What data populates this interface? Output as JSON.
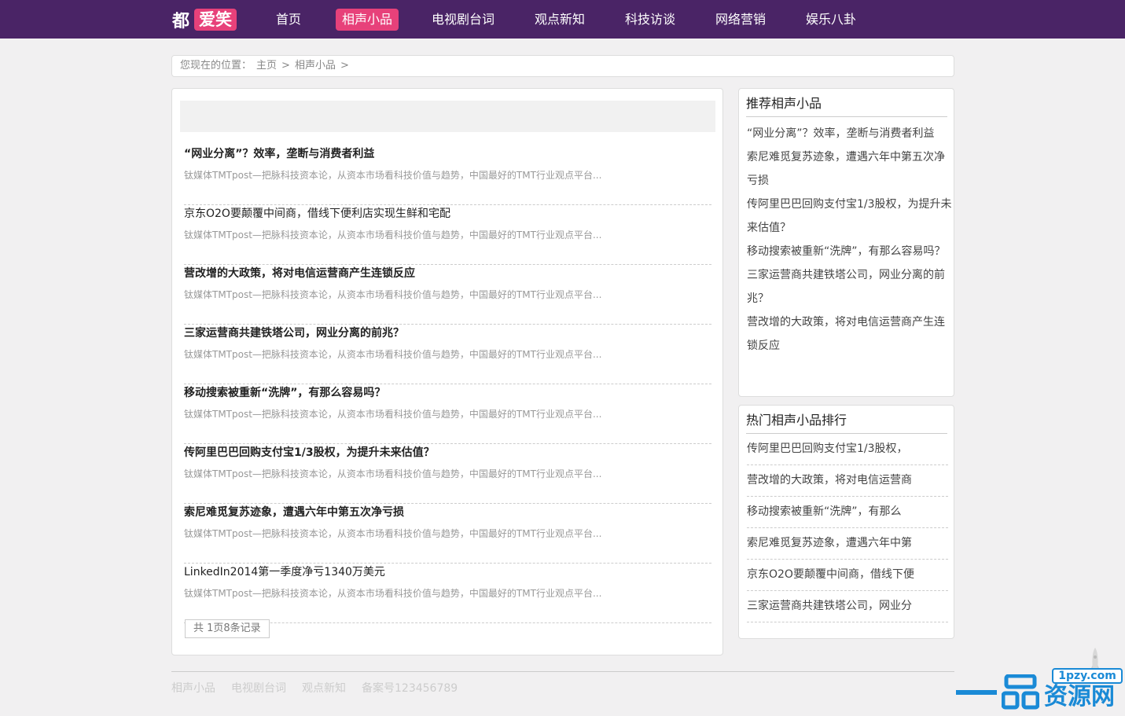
{
  "header": {
    "logo_main": "都",
    "logo_tag": "爱笑",
    "nav": [
      {
        "label": "首页",
        "active": false
      },
      {
        "label": "相声小品",
        "active": true
      },
      {
        "label": "电视剧台词",
        "active": false
      },
      {
        "label": "观点新知",
        "active": false
      },
      {
        "label": "科技访谈",
        "active": false
      },
      {
        "label": "网络营销",
        "active": false
      },
      {
        "label": "娱乐八卦",
        "active": false
      }
    ]
  },
  "breadcrumb": {
    "prefix": "您现在的位置：",
    "home": "主页",
    "sep": ">",
    "current": "相声小品",
    "trail_end": ">"
  },
  "articles": [
    {
      "title": "“网业分离”？效率，垄断与消费者利益",
      "bold": true,
      "summary": "钛媒体TMTpost—把脉科技资本论，从资本市场看科技价值与趋势，中国最好的TMT行业观点平台..."
    },
    {
      "title": "京东O2O要颠覆中间商，借线下便利店实现生鲜和宅配",
      "bold": false,
      "summary": "钛媒体TMTpost—把脉科技资本论，从资本市场看科技价值与趋势，中国最好的TMT行业观点平台..."
    },
    {
      "title": "营改增的大政策，将对电信运营商产生连锁反应",
      "bold": true,
      "summary": "钛媒体TMTpost—把脉科技资本论，从资本市场看科技价值与趋势，中国最好的TMT行业观点平台..."
    },
    {
      "title": "三家运营商共建铁塔公司，网业分离的前兆？",
      "bold": true,
      "summary": "钛媒体TMTpost—把脉科技资本论，从资本市场看科技价值与趋势，中国最好的TMT行业观点平台..."
    },
    {
      "title": "移动搜索被重新“洗牌”，有那么容易吗？",
      "bold": true,
      "summary": "钛媒体TMTpost—把脉科技资本论，从资本市场看科技价值与趋势，中国最好的TMT行业观点平台..."
    },
    {
      "title": "传阿里巴巴回购支付宝1/3股权，为提升未来估值？",
      "bold": true,
      "summary": "钛媒体TMTpost—把脉科技资本论，从资本市场看科技价值与趋势，中国最好的TMT行业观点平台..."
    },
    {
      "title": "索尼难觅复苏迹象，遭遇六年中第五次净亏损",
      "bold": true,
      "summary": "钛媒体TMTpost—把脉科技资本论，从资本市场看科技价值与趋势，中国最好的TMT行业观点平台..."
    },
    {
      "title": "LinkedIn2014第一季度净亏1340万美元",
      "bold": false,
      "summary": "钛媒体TMTpost—把脉科技资本论，从资本市场看科技价值与趋势，中国最好的TMT行业观点平台..."
    }
  ],
  "pager": "共  1页8条记录",
  "recommend": {
    "title": "推荐相声小品",
    "items": [
      "“网业分离”？效率，垄断与消费者利益",
      "索尼难觅复苏迹象，遭遇六年中第五次净亏损",
      "传阿里巴巴回购支付宝1/3股权，为提升未来估值？",
      "移动搜索被重新“洗牌”，有那么容易吗？",
      "三家运营商共建铁塔公司，网业分离的前兆？",
      "营改增的大政策，将对电信运营商产生连锁反应"
    ]
  },
  "hot": {
    "title": "热门相声小品排行",
    "items": [
      "传阿里巴巴回购支付宝1/3股权，",
      "营改增的大政策，将对电信运营商",
      "移动搜索被重新“洗牌”，有那么",
      "索尼难觅复苏迹象，遭遇六年中第",
      "京东O2O要颠覆中间商，借线下便",
      "三家运营商共建铁塔公司，网业分"
    ]
  },
  "footer": {
    "links": [
      "相声小品",
      "电视剧台词",
      "观点新知"
    ],
    "icp": "备案号123456789"
  },
  "watermark": {
    "site": "1pzy.com",
    "text": "资源网"
  },
  "colors": {
    "header_bg": "#4a2466",
    "accent": "#e7417a",
    "page_bg": "#f1f0f1",
    "watermark": "#1a8ad6"
  }
}
